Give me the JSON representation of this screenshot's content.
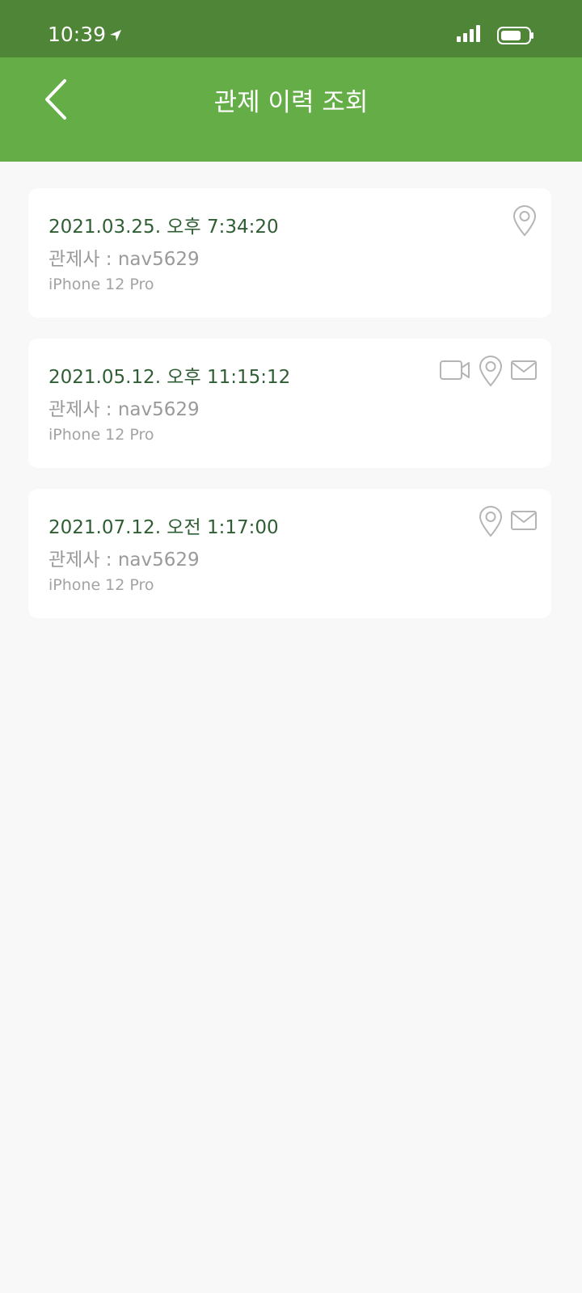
{
  "status_bar": {
    "time": "10:39"
  },
  "header": {
    "title": "관제 이력 조회"
  },
  "records": [
    {
      "datetime": "2021.03.25. 오후 7:34:20",
      "operator": "관제사 : nav5629",
      "device": "iPhone 12 Pro",
      "icons": [
        "location-pin-icon"
      ]
    },
    {
      "datetime": "2021.05.12. 오후 11:15:12",
      "operator": "관제사 : nav5629",
      "device": "iPhone 12 Pro",
      "icons": [
        "video-camera-icon",
        "location-pin-icon",
        "mail-envelope-icon"
      ]
    },
    {
      "datetime": "2021.07.12. 오전 1:17:00",
      "operator": "관제사 : nav5629",
      "device": "iPhone 12 Pro",
      "icons": [
        "location-pin-icon",
        "mail-envelope-icon"
      ]
    }
  ],
  "colors": {
    "status_bar": "#4e8536",
    "header": "#64ad47",
    "datetime_text": "#2f5e34",
    "secondary_text": "#9a9a9a",
    "background": "#f8f8f8",
    "icon_gray": "#b5b5b5"
  }
}
